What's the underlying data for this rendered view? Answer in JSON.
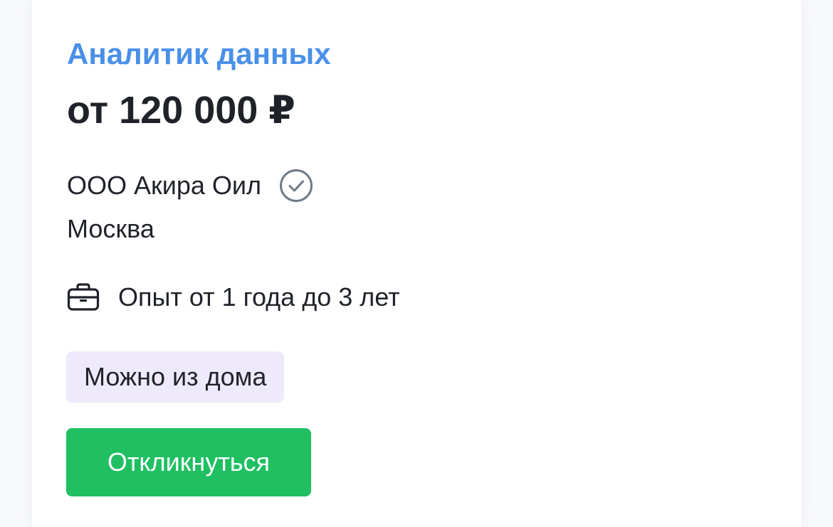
{
  "vacancy": {
    "title": "Аналитик данных",
    "salary": "от 120 000 ₽",
    "company": "ООО Акира Оил",
    "city": "Москва",
    "experience": "Опыт от 1 года до 3 лет",
    "tag": "Можно из дома",
    "apply_label": "Откликнуться"
  },
  "icons": {
    "verified": "check-circle-icon",
    "experience": "briefcase-icon"
  },
  "colors": {
    "title": "#4a90e8",
    "text": "#1f2329",
    "verified_icon": "#6f7a86",
    "tag_background": "#eeeafb",
    "apply_button": "#1fbf62",
    "apply_text": "#ffffff"
  }
}
